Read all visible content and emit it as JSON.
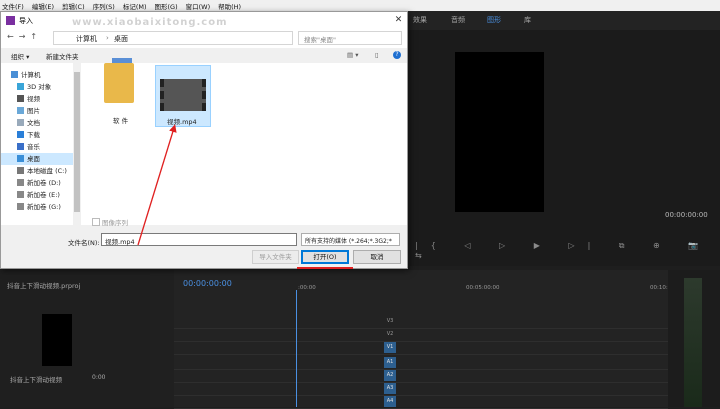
{
  "menubar": [
    "文件(F)",
    "编辑(E)",
    "剪辑(C)",
    "序列(S)",
    "标记(M)",
    "图形(G)",
    "窗口(W)",
    "帮助(H)"
  ],
  "workspace_tabs": [
    "效果",
    "音频",
    "图形",
    "库"
  ],
  "watermark": "www.xiaobaixitong.com",
  "dialog": {
    "title": "导入",
    "close": "✕",
    "address": [
      "计算机",
      "桌面"
    ],
    "search_placeholder": "搜索\"桌面\"",
    "organize": "组织 ▾",
    "new_folder": "新建文件夹",
    "sidebar": [
      "计算机",
      "3D 对象",
      "视频",
      "图片",
      "文档",
      "下载",
      "音乐",
      "桌面",
      "本地磁盘 (C:)",
      "新加卷 (D:)",
      "新加卷 (E:)",
      "新加卷 (G:)"
    ],
    "selected_sidebar": "桌面",
    "files": [
      {
        "label": "软 件"
      },
      {
        "label": "视频.mp4"
      }
    ],
    "hide_extension_label": "图像序列",
    "filename_label": "文件名(N):",
    "filename_value": "视频.mp4",
    "filetype_value": "所有支持的媒体 (*.264;*.3G2;*",
    "import_folder_button": "导入文件夹",
    "open_button": "打开(O)",
    "cancel_button": "取消"
  },
  "monitor": {
    "timecode": "00:00:00:00"
  },
  "project": {
    "title": "抖音上下滑动视频.prproj",
    "caption": "抖音上下滑动视频",
    "duration": "0:00"
  },
  "timeline": {
    "timecode": "00:00:00:00",
    "ruler": [
      ":00:00",
      "00:05:00:00",
      "00:10:00"
    ],
    "tracks": [
      "V3",
      "V2",
      "V1",
      "A1",
      "A2",
      "A3",
      "A4"
    ]
  }
}
